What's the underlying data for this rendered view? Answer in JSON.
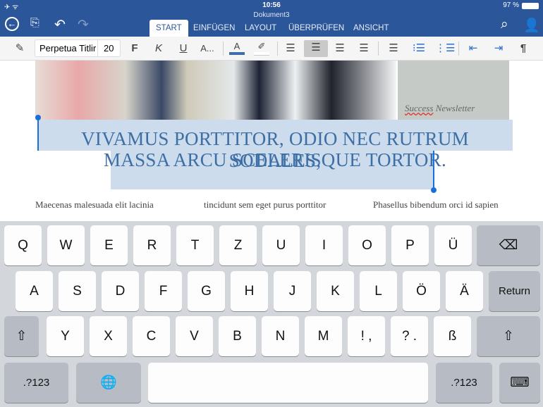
{
  "status": {
    "time": "10:56",
    "battery": "97 %"
  },
  "window": {
    "title": "Dokument3"
  },
  "tabs": [
    {
      "label": "START"
    },
    {
      "label": "EINFÜGEN"
    },
    {
      "label": "LAYOUT"
    },
    {
      "label": "ÜBERPRÜFEN"
    },
    {
      "label": "ANSICHT"
    }
  ],
  "ribbon": {
    "font_name": "Perpetua Titlir",
    "font_size": "20",
    "bold": "F",
    "italic": "K",
    "underline": "U",
    "more": "A...",
    "font_color": "A",
    "pilcrow": "¶",
    "font_color_hex": "#3d6fa5"
  },
  "document": {
    "sidebar_text_1": "Success",
    "sidebar_text_2": " Newsletter",
    "heading_line1": "Vivamus porttitor, odio nec rutrum sodales,",
    "heading_line2": "massa arcu scelerisque tortor.",
    "columns": [
      "Maecenas malesuada elit lacinia",
      "tincidunt sem eget purus porttitor",
      "Phasellus bibendum orci id sapien"
    ]
  },
  "keyboard": {
    "rows": [
      [
        {
          "l": "Q"
        },
        {
          "l": "W"
        },
        {
          "l": "E"
        },
        {
          "l": "R"
        },
        {
          "l": "T"
        },
        {
          "l": "Z"
        },
        {
          "l": "U"
        },
        {
          "l": "I"
        },
        {
          "l": "O"
        },
        {
          "l": "P"
        },
        {
          "l": "Ü"
        }
      ],
      [
        {
          "l": "A"
        },
        {
          "l": "S"
        },
        {
          "l": "D"
        },
        {
          "l": "F"
        },
        {
          "l": "G"
        },
        {
          "l": "H"
        },
        {
          "l": "J"
        },
        {
          "l": "K"
        },
        {
          "l": "L"
        },
        {
          "l": "Ö"
        },
        {
          "l": "Ä"
        }
      ],
      [
        {
          "l": "Y"
        },
        {
          "l": "X"
        },
        {
          "l": "C"
        },
        {
          "l": "V"
        },
        {
          "l": "B"
        },
        {
          "l": "N"
        },
        {
          "l": "M"
        },
        {
          "l": "! ,"
        },
        {
          "l": "? ."
        },
        {
          "l": "ß"
        }
      ]
    ],
    "return": "Return",
    "numbers": ".?123",
    "backspace": "⌫",
    "shift": "⇧",
    "globe": "🌐",
    "hide": "⌨"
  }
}
